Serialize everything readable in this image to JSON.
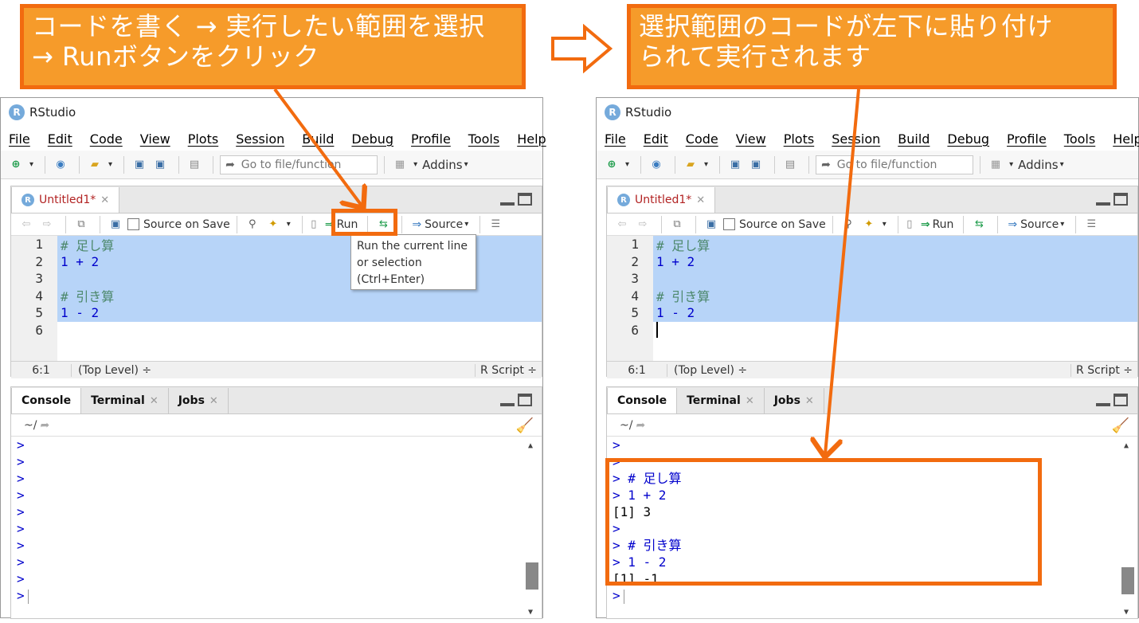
{
  "callouts": {
    "left": {
      "line1": "コードを書く → 実行したい範囲を選択",
      "line2": "→ Runボタンをクリック"
    },
    "right": {
      "line1": "選択範囲のコードが左下に貼り付け",
      "line2": "られて実行されます"
    }
  },
  "window": {
    "title": "RStudio",
    "logo": "R"
  },
  "menu": [
    "File",
    "Edit",
    "Code",
    "View",
    "Plots",
    "Session",
    "Build",
    "Debug",
    "Profile",
    "Tools",
    "Help"
  ],
  "toolbar": {
    "goto_placeholder": "Go to file/function",
    "addins": "Addins"
  },
  "editor": {
    "tab_label": "Untitled1*",
    "source_on_save": "Source on Save",
    "run_label": "Run",
    "source_label": "Source",
    "lines": [
      {
        "num": "1",
        "text": "# 足し算"
      },
      {
        "num": "2",
        "text": "1 + 2"
      },
      {
        "num": "3",
        "text": ""
      },
      {
        "num": "4",
        "text": "# 引き算"
      },
      {
        "num": "5",
        "text": "1 - 2"
      },
      {
        "num": "6",
        "text": ""
      }
    ],
    "status_pos": "6:1",
    "status_scope": "(Top Level) ÷",
    "status_type": "R Script ÷"
  },
  "tooltip": {
    "line1": "Run the current line",
    "line2": "or selection",
    "line3": "(Ctrl+Enter)"
  },
  "console": {
    "tabs": [
      "Console",
      "Terminal",
      "Jobs"
    ],
    "path": "~/",
    "prompt": ">",
    "output_lines": [
      {
        "text": "> # 足し算",
        "kind": "input"
      },
      {
        "text": "> 1 + 2",
        "kind": "input"
      },
      {
        "text": "[1] 3",
        "kind": "output"
      },
      {
        "text": ">",
        "kind": "input"
      },
      {
        "text": "> # 引き算",
        "kind": "input"
      },
      {
        "text": "> 1 - 2",
        "kind": "input"
      },
      {
        "text": "[1] -1",
        "kind": "output"
      },
      {
        "text": ">",
        "kind": "input"
      }
    ]
  },
  "colors": {
    "callout_fill": "#f69b2a",
    "callout_border": "#f26b0f",
    "selection": "#b7d4f8",
    "comment": "#4c886b",
    "code_number": "#0000cc"
  }
}
